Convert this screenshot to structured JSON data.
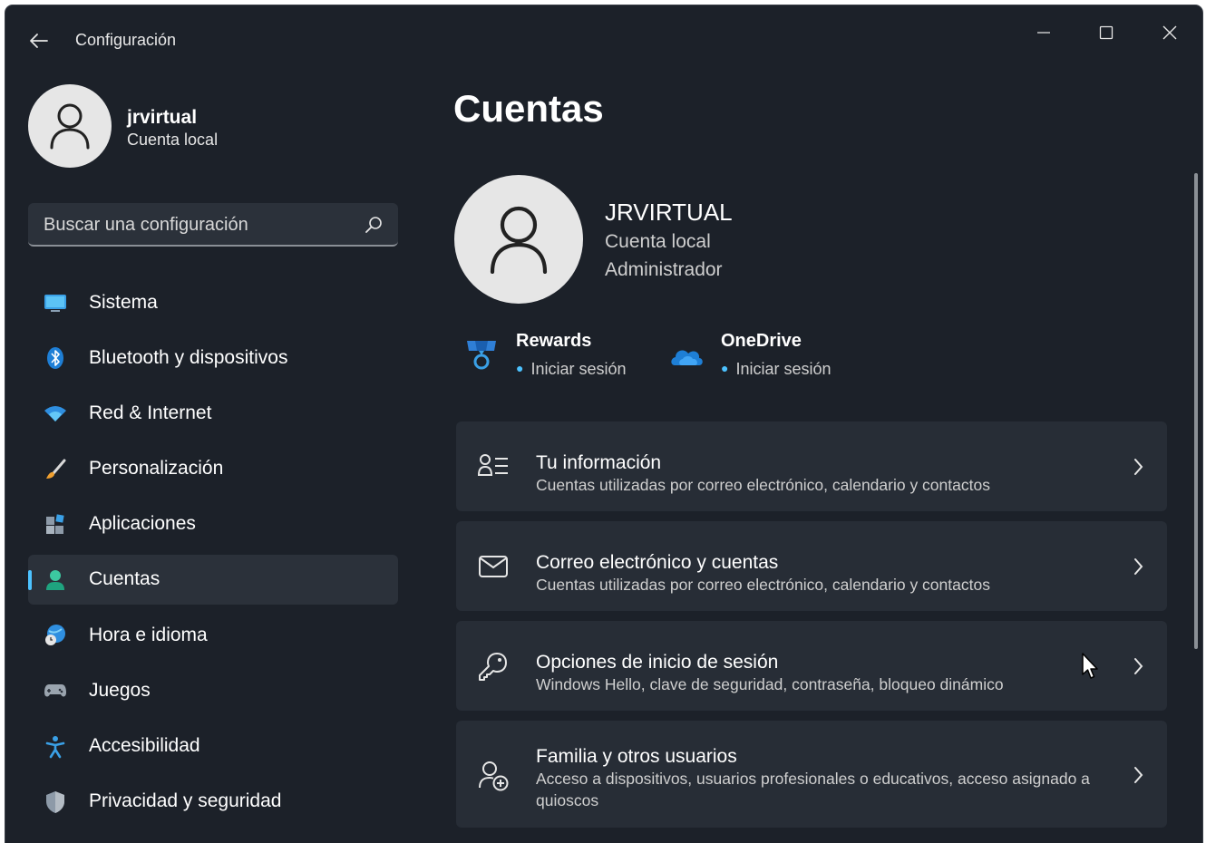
{
  "window": {
    "title": "Configuración"
  },
  "profile": {
    "name": "jrvirtual",
    "subtitle": "Cuenta local"
  },
  "search": {
    "placeholder": "Buscar una configuración"
  },
  "sidebar": {
    "items": [
      {
        "label": "Sistema",
        "icon": "monitor-icon",
        "selected": false
      },
      {
        "label": "Bluetooth y dispositivos",
        "icon": "bluetooth-icon",
        "selected": false
      },
      {
        "label": "Red & Internet",
        "icon": "wifi-icon",
        "selected": false
      },
      {
        "label": "Personalización",
        "icon": "brush-icon",
        "selected": false
      },
      {
        "label": "Aplicaciones",
        "icon": "apps-icon",
        "selected": false
      },
      {
        "label": "Cuentas",
        "icon": "person-icon",
        "selected": true
      },
      {
        "label": "Hora e idioma",
        "icon": "globe-clock-icon",
        "selected": false
      },
      {
        "label": "Juegos",
        "icon": "gamepad-icon",
        "selected": false
      },
      {
        "label": "Accesibilidad",
        "icon": "accessibility-icon",
        "selected": false
      },
      {
        "label": "Privacidad y seguridad",
        "icon": "shield-icon",
        "selected": false
      }
    ]
  },
  "main": {
    "title": "Cuentas",
    "account": {
      "name": "JRVIRTUAL",
      "type": "Cuenta local",
      "role": "Administrador"
    },
    "services": [
      {
        "name": "Rewards",
        "status": "Iniciar sesión",
        "icon": "rewards-medal-icon"
      },
      {
        "name": "OneDrive",
        "status": "Iniciar sesión",
        "icon": "onedrive-cloud-icon"
      }
    ],
    "cards": [
      {
        "title": "Tu información",
        "desc": "Cuentas utilizadas por correo electrónico, calendario y contactos",
        "icon": "person-info-icon"
      },
      {
        "title": "Correo electrónico y cuentas",
        "desc": "Cuentas utilizadas por correo electrónico, calendario y contactos",
        "icon": "mail-icon"
      },
      {
        "title": "Opciones de inicio de sesión",
        "desc": "Windows Hello, clave de seguridad, contraseña, bloqueo dinámico",
        "icon": "key-icon"
      },
      {
        "title": "Familia y otros usuarios",
        "desc": "Acceso a dispositivos, usuarios profesionales o educativos, acceso asignado a quioscos",
        "icon": "person-add-icon"
      }
    ]
  },
  "colors": {
    "background": "#1c2129",
    "card": "#272d36",
    "accent": "#4cc2ff"
  }
}
